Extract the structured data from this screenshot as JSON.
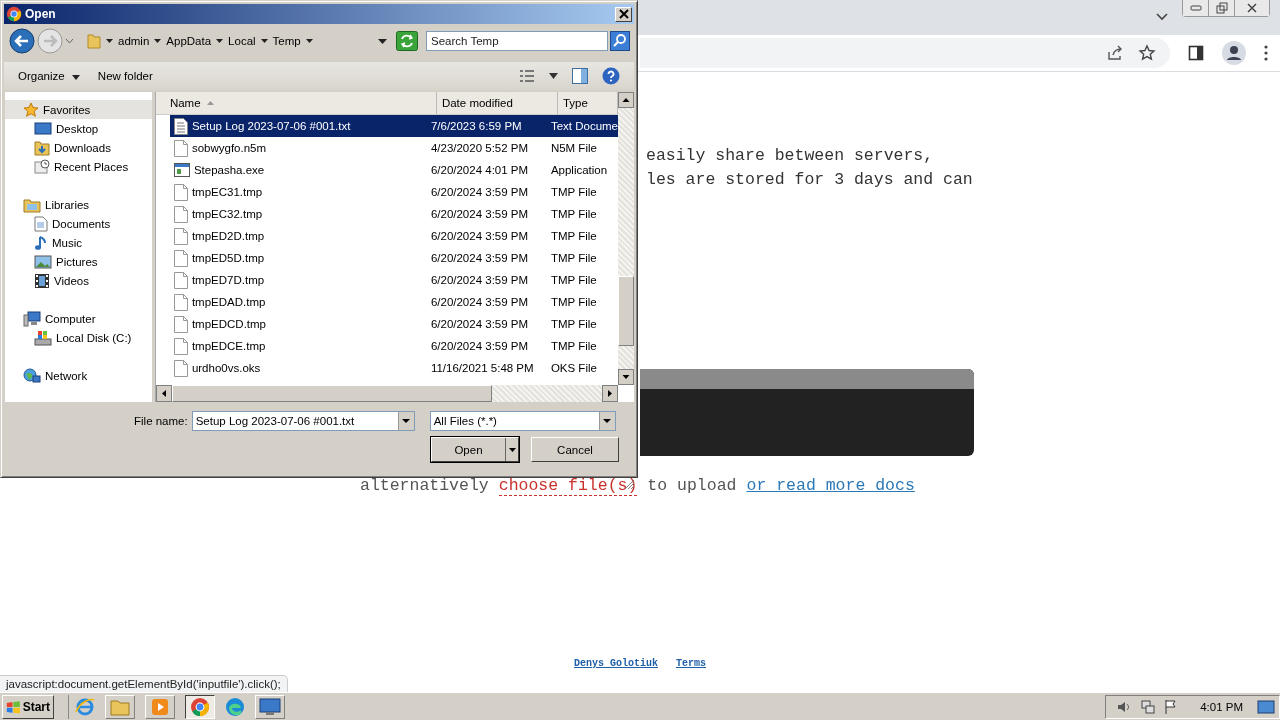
{
  "browser": {
    "page_lines": [
      "easily share between servers,",
      "les are stored for 3 days and can"
    ],
    "upload_hint": {
      "before": "alternatively",
      "choose_link": "choose file(s)",
      "middle": "to upload",
      "docs_link": "or read more docs"
    },
    "footer_links": [
      "Denys Golotiuk",
      "Terms"
    ],
    "status_url": "javascript:document.getElementById('inputfile').click();"
  },
  "dialog": {
    "title": "Open",
    "breadcrumb": [
      "admin",
      "AppData",
      "Local",
      "Temp"
    ],
    "search": {
      "placeholder": "Search Temp"
    },
    "toolbar": [
      "Organize",
      "New folder"
    ],
    "sidebar": [
      {
        "label": "Favorites",
        "selected": true,
        "children": [
          {
            "label": "Desktop",
            "selected": false
          },
          {
            "label": "Downloads",
            "selected": false
          },
          {
            "label": "Recent Places",
            "selected": false
          }
        ]
      },
      {
        "label": "Libraries",
        "selected": false,
        "children": [
          {
            "label": "Documents",
            "selected": false
          },
          {
            "label": "Music",
            "selected": false
          },
          {
            "label": "Pictures",
            "selected": false
          },
          {
            "label": "Videos",
            "selected": false
          }
        ]
      },
      {
        "label": "Computer",
        "selected": false,
        "children": [
          {
            "label": "Local Disk (C:)",
            "selected": false
          }
        ]
      },
      {
        "label": "Network",
        "selected": false
      }
    ],
    "columns": [
      {
        "label": "Name",
        "sorted": true
      },
      {
        "label": "Date modified",
        "sorted": false
      },
      {
        "label": "Type",
        "sorted": false
      }
    ],
    "rows": [
      {
        "name": "Setup Log 2023-07-06 #001.txt",
        "date": "7/6/2023 6:59 PM",
        "type": "Text Docume",
        "kind": "text",
        "selected": true
      },
      {
        "name": "sobwygfo.n5m",
        "date": "4/23/2020 5:52 PM",
        "type": "N5M File",
        "kind": "file",
        "selected": false
      },
      {
        "name": "Stepasha.exe",
        "date": "6/20/2024 4:01 PM",
        "type": "Application",
        "kind": "app",
        "selected": false
      },
      {
        "name": "tmpEC31.tmp",
        "date": "6/20/2024 3:59 PM",
        "type": "TMP File",
        "kind": "file",
        "selected": false
      },
      {
        "name": "tmpEC32.tmp",
        "date": "6/20/2024 3:59 PM",
        "type": "TMP File",
        "kind": "file",
        "selected": false
      },
      {
        "name": "tmpED2D.tmp",
        "date": "6/20/2024 3:59 PM",
        "type": "TMP File",
        "kind": "file",
        "selected": false
      },
      {
        "name": "tmpED5D.tmp",
        "date": "6/20/2024 3:59 PM",
        "type": "TMP File",
        "kind": "file",
        "selected": false
      },
      {
        "name": "tmpED7D.tmp",
        "date": "6/20/2024 3:59 PM",
        "type": "TMP File",
        "kind": "file",
        "selected": false
      },
      {
        "name": "tmpEDAD.tmp",
        "date": "6/20/2024 3:59 PM",
        "type": "TMP File",
        "kind": "file",
        "selected": false
      },
      {
        "name": "tmpEDCD.tmp",
        "date": "6/20/2024 3:59 PM",
        "type": "TMP File",
        "kind": "file",
        "selected": false
      },
      {
        "name": "tmpEDCE.tmp",
        "date": "6/20/2024 3:59 PM",
        "type": "TMP File",
        "kind": "file",
        "selected": false
      },
      {
        "name": "urdho0vs.oks",
        "date": "11/16/2021 5:48 PM",
        "type": "OKS File",
        "kind": "file",
        "selected": false
      }
    ],
    "file_name_label": "File name:",
    "file_name": "Setup Log 2023-07-06 #001.txt",
    "file_type": "All Files (*.*)",
    "buttons": [
      "Open",
      "Cancel"
    ]
  },
  "taskbar": {
    "start": "Start",
    "clock": "4:01 PM"
  }
}
